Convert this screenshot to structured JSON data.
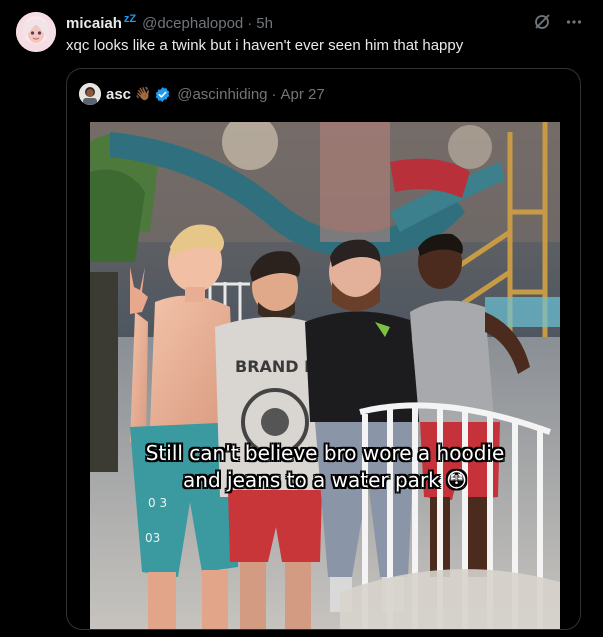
{
  "tweet": {
    "author": {
      "display_name": "micaiah",
      "badge": "zZ",
      "handle": "@dcephalopod",
      "separator": "·",
      "time": "5h"
    },
    "text": "xqc looks like a twink but i haven't ever seen him that happy",
    "actions": {
      "grok_icon": "grok-icon",
      "more_icon": "more-icon"
    }
  },
  "quote": {
    "author": {
      "display_name": "asc",
      "emoji": "👋🏾",
      "verified": true,
      "handle": "@ascinhiding",
      "separator": "·",
      "time": "Apr 27"
    },
    "media": {
      "caption_line1": "Still can't believe bro wore a hoodie",
      "caption_line2": "and jeans to a water park 😳",
      "hoodie_text": "BRAND BU"
    }
  },
  "colors": {
    "background": "#000000",
    "text_primary": "#e7e9ea",
    "text_secondary": "#71767b",
    "border": "#2f3336",
    "verified_blue": "#1d9bf0"
  }
}
